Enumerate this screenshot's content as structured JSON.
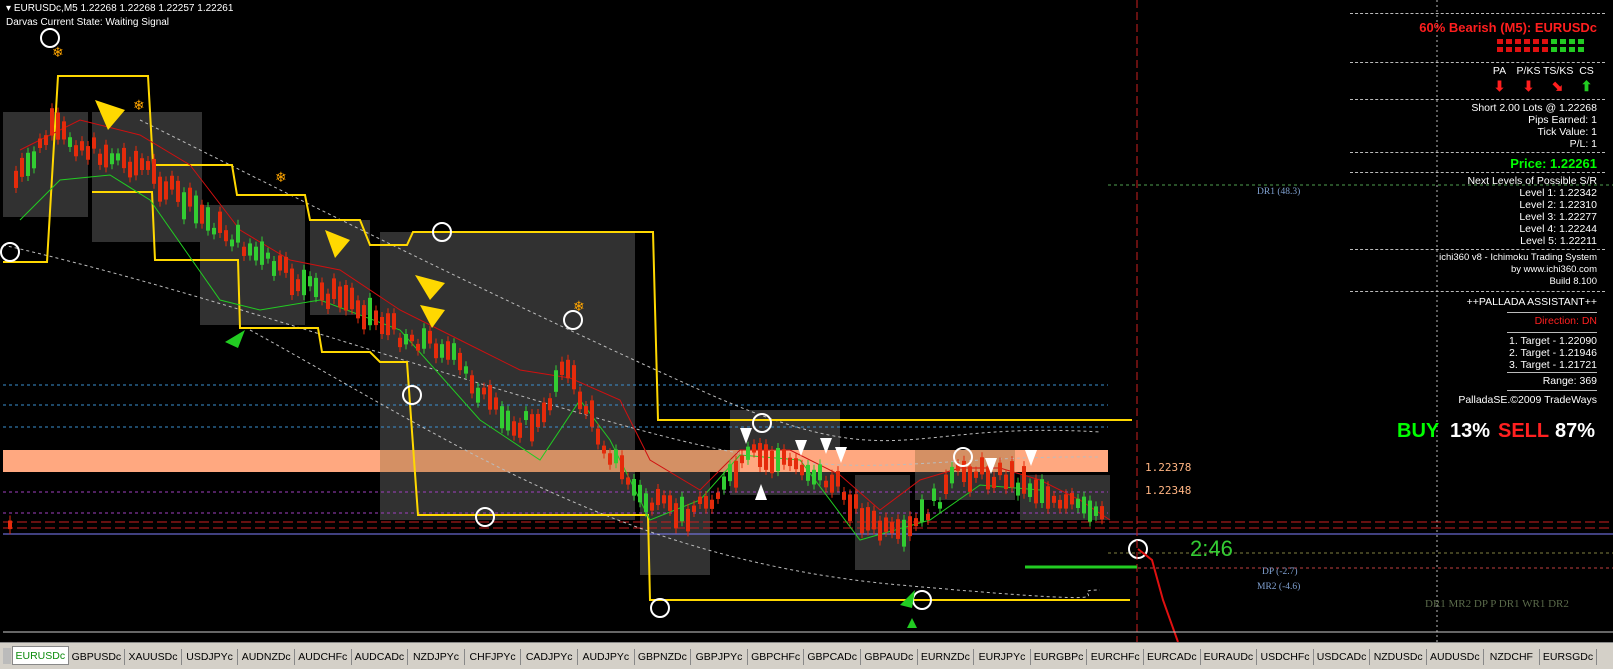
{
  "chart": {
    "symbol_header": "EURUSDc,M5  1.22268 1.22268 1.22257 1.22261",
    "darvas_state": "Darvas Current State: Waiting Signal",
    "level_upper": "1.22378",
    "level_lower": "1.22348",
    "countdown": "2:46",
    "pivot_labels": {
      "dr1": "DR1 (48.3)",
      "dp": "DP (-2.7)",
      "mr2": "MR2 (-4.6)",
      "legend": "DR1 MR2 DP P DR1 WR1 DR2"
    },
    "colors": {
      "bear_candle": "#e52b0b",
      "bull_candle": "#32cd32",
      "sr_zone": "#ffa880",
      "darvas_box": "#ffd800",
      "background": "#000000"
    }
  },
  "panel": {
    "title": "60% Bearish (M5): EURUSDc",
    "indicator_headers": [
      "PA",
      "P/KS",
      "TS/KS",
      "CS"
    ],
    "indicator_signals": [
      "down",
      "down",
      "down-right",
      "up"
    ],
    "position": "Short 2.00 Lots @ 1.22268",
    "pips_earned": "Pips Earned: 1",
    "tick_value": "Tick Value: 1",
    "pl": "P/L: 1",
    "price": "Price: 1.22261",
    "levels_header": "Next Levels of Possible S/R",
    "levels": [
      "Level 1: 1.22342",
      "Level 2: 1.22310",
      "Level 3: 1.22277",
      "Level 4: 1.22244",
      "Level 5: 1.22211"
    ],
    "brand_line1": "ichi360 v8 - Ichimoku Trading System",
    "brand_line2": "by www.ichi360.com",
    "brand_line3": "Build 8.100",
    "palladа_title": "++PALLADA ASSISTANT++",
    "direction": "Direction: DN",
    "targets": [
      "1. Target - 1.22090",
      "2. Target - 1.21946",
      "3. Target - 1.21721"
    ],
    "range": "Range: 369",
    "copyright": "PalladaSE.©2009 TradeWays",
    "buy_label": "BUY",
    "buy_pct": "13%",
    "sell_label": "SELL",
    "sell_pct": "87%"
  },
  "tabs": [
    "EURUSDc",
    "GBPUSDc",
    "XAUUSDc",
    "USDJPYc",
    "AUDNZDc",
    "AUDCHFc",
    "AUDCADc",
    "NZDJPYc",
    "CHFJPYc",
    "CADJPYc",
    "AUDJPYc",
    "GBPNZDc",
    "GBPJPYc",
    "GBPCHFc",
    "GBPCADc",
    "GBPAUDc",
    "EURNZDc",
    "EURJPYc",
    "EURGBPc",
    "EURCHFc",
    "EURCADc",
    "EURAUDc",
    "USDCHFc",
    "USDCADc",
    "NZDUSDc",
    "AUDUSDc",
    "NZDCHF",
    "EURSGDc"
  ],
  "active_tab": "EURUSDc"
}
